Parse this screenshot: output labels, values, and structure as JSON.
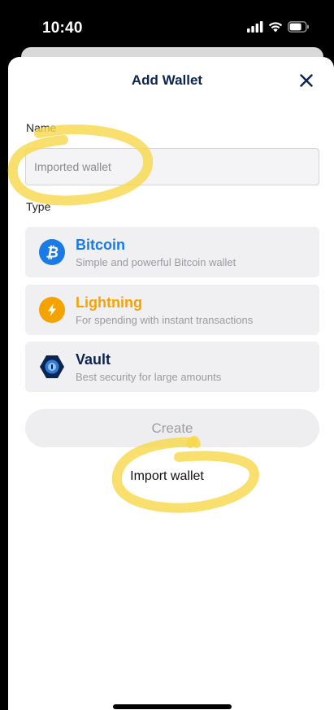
{
  "status_bar": {
    "time": "10:40"
  },
  "header": {
    "title": "Add Wallet"
  },
  "form": {
    "name_label": "Name",
    "name_placeholder": "Imported wallet",
    "type_label": "Type"
  },
  "wallet_types": [
    {
      "title": "Bitcoin",
      "description": "Simple and powerful Bitcoin wallet",
      "color": "#1a7ae6"
    },
    {
      "title": "Lightning",
      "description": "For spending with instant transactions",
      "color": "#f5a300"
    },
    {
      "title": "Vault",
      "description": "Best security for large amounts",
      "color": "#0c2550"
    }
  ],
  "actions": {
    "create_label": "Create",
    "import_label": "Import wallet"
  },
  "colors": {
    "highlight": "#f8d84a",
    "title_navy": "#0c2550",
    "bitcoin_blue": "#1a7ae6",
    "lightning_orange": "#f5a300"
  }
}
